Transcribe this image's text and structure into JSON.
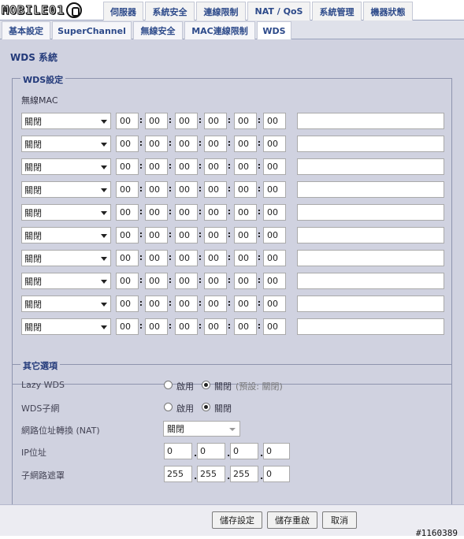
{
  "logo": {
    "text": "MOBILE01"
  },
  "top_tabs": [
    "伺服器",
    "系統安全",
    "連線限制",
    "NAT / QoS",
    "系統管理",
    "機器狀態"
  ],
  "sub_tabs": [
    "基本設定",
    "SuperChannel",
    "無線安全",
    "MAC連線限制",
    "WDS"
  ],
  "active_sub_tab": "WDS",
  "page_title": "WDS 系統",
  "wds": {
    "legend": "WDS設定",
    "mac_label": "無線MAC",
    "rows": [
      {
        "mode": "關閉",
        "mac": [
          "00",
          "00",
          "00",
          "00",
          "00",
          "00"
        ],
        "desc": ""
      },
      {
        "mode": "關閉",
        "mac": [
          "00",
          "00",
          "00",
          "00",
          "00",
          "00"
        ],
        "desc": ""
      },
      {
        "mode": "關閉",
        "mac": [
          "00",
          "00",
          "00",
          "00",
          "00",
          "00"
        ],
        "desc": ""
      },
      {
        "mode": "關閉",
        "mac": [
          "00",
          "00",
          "00",
          "00",
          "00",
          "00"
        ],
        "desc": ""
      },
      {
        "mode": "關閉",
        "mac": [
          "00",
          "00",
          "00",
          "00",
          "00",
          "00"
        ],
        "desc": ""
      },
      {
        "mode": "關閉",
        "mac": [
          "00",
          "00",
          "00",
          "00",
          "00",
          "00"
        ],
        "desc": ""
      },
      {
        "mode": "關閉",
        "mac": [
          "00",
          "00",
          "00",
          "00",
          "00",
          "00"
        ],
        "desc": ""
      },
      {
        "mode": "關閉",
        "mac": [
          "00",
          "00",
          "00",
          "00",
          "00",
          "00"
        ],
        "desc": ""
      },
      {
        "mode": "關閉",
        "mac": [
          "00",
          "00",
          "00",
          "00",
          "00",
          "00"
        ],
        "desc": ""
      },
      {
        "mode": "關閉",
        "mac": [
          "00",
          "00",
          "00",
          "00",
          "00",
          "00"
        ],
        "desc": ""
      }
    ]
  },
  "other": {
    "legend": "其它選項",
    "lazy_wds": {
      "label": "Lazy WDS",
      "on_label": "啟用",
      "off_label": "關閉",
      "hint": "(預設: 關閉)",
      "selected": "off"
    },
    "wds_subnet": {
      "label": "WDS子網",
      "on_label": "啟用",
      "off_label": "關閉",
      "selected": "off"
    },
    "nat": {
      "label": "網路位址轉換 (NAT)",
      "value": "關閉"
    },
    "ip": {
      "label": "IP位址",
      "values": [
        "0",
        "0",
        "0",
        "0"
      ]
    },
    "mask": {
      "label": "子網路遮罩",
      "values": [
        "255",
        "255",
        "255",
        "0"
      ]
    }
  },
  "buttons": {
    "save": "儲存設定",
    "save_restart": "儲存重啟",
    "cancel": "取消"
  },
  "watermark": "#1160389"
}
